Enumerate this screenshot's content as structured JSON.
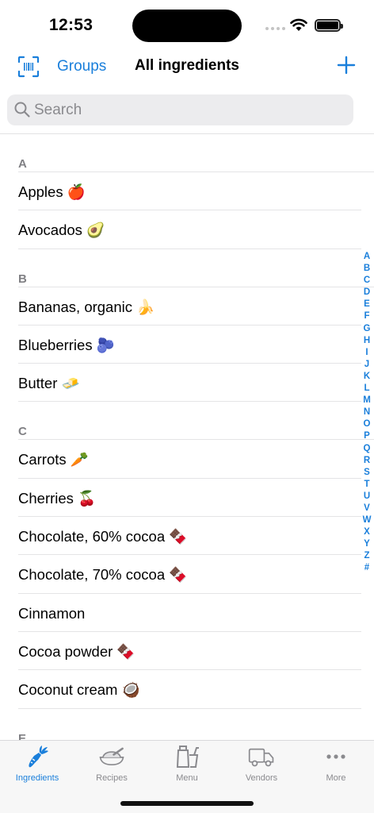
{
  "status_bar": {
    "time": "12:53"
  },
  "nav": {
    "groups_label": "Groups",
    "title": "All ingredients"
  },
  "search": {
    "placeholder": "Search",
    "value": ""
  },
  "sections": [
    {
      "letter": "A",
      "items": [
        "Apples 🍎",
        "Avocados 🥑"
      ]
    },
    {
      "letter": "B",
      "items": [
        "Bananas, organic 🍌",
        "Blueberries 🫐",
        "Butter 🧈"
      ]
    },
    {
      "letter": "C",
      "items": [
        "Carrots 🥕",
        "Cherries 🍒",
        "Chocolate, 60% cocoa 🍫",
        "Chocolate, 70% cocoa 🍫",
        "Cinnamon",
        "Cocoa powder 🍫",
        "Coconut cream 🥥"
      ]
    },
    {
      "letter": "E",
      "items": []
    }
  ],
  "alphabet_index": [
    "A",
    "B",
    "C",
    "D",
    "E",
    "F",
    "G",
    "H",
    "I",
    "J",
    "K",
    "L",
    "M",
    "N",
    "O",
    "P",
    "Q",
    "R",
    "S",
    "T",
    "U",
    "V",
    "W",
    "X",
    "Y",
    "Z",
    "#"
  ],
  "tabs": [
    {
      "label": "Ingredients",
      "icon": "carrot-icon",
      "active": true
    },
    {
      "label": "Recipes",
      "icon": "bowl-icon",
      "active": false
    },
    {
      "label": "Menu",
      "icon": "takeaway-icon",
      "active": false
    },
    {
      "label": "Vendors",
      "icon": "truck-icon",
      "active": false
    },
    {
      "label": "More",
      "icon": "ellipsis-icon",
      "active": false
    }
  ],
  "colors": {
    "accent": "#1a7fdb",
    "inactive": "#8a8a8e",
    "tabbar_bg": "#f7f7f7"
  }
}
